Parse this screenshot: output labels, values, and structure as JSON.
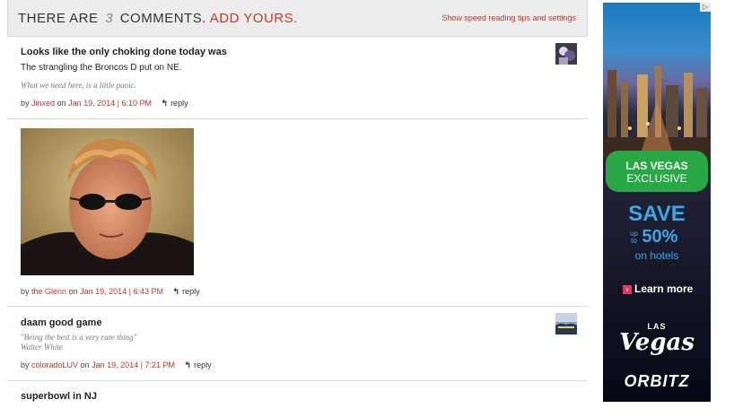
{
  "header": {
    "prefix": "THERE ARE",
    "count": "3",
    "suffix": "COMMENTS.",
    "add_label": "ADD YOURS.",
    "speed_link": "Show speed reading tips and settings"
  },
  "comments": [
    {
      "title": "Looks like the only choking done today was",
      "body": "The strangling the Broncos D put on NE.",
      "signature": [
        "What we need here, is a little panic."
      ],
      "by": "by",
      "author": "Jinxed",
      "on": "on",
      "date": "Jan 19, 2014 | 6:10 PM",
      "reply": "reply"
    },
    {
      "by": "by",
      "author": "the Glenn",
      "on": "on",
      "date": "Jan 19, 2014 | 6:43 PM",
      "reply": "reply"
    },
    {
      "title": "daam good game",
      "signature": [
        "\"Being the best is a very rare thing\"",
        "Walter White"
      ],
      "by": "by",
      "author": "coloradoLUV",
      "on": "on",
      "date": "Jan 19, 2014 | 7:21 PM",
      "reply": "reply"
    },
    {
      "title": "superbowl in NJ"
    }
  ],
  "ad": {
    "badge_line1": "LAS VEGAS",
    "badge_line2": "EXCLUSIVE",
    "save": "SAVE",
    "upto_1": "up",
    "upto_2": "to",
    "percent": "50%",
    "on_hotels": "on hotels",
    "learn_more": "Learn more",
    "logo_top": "LAS",
    "logo_script": "Vegas",
    "orbitz": "ORBITZ"
  },
  "colors": {
    "accent_red": "#c0392b",
    "ad_green": "#27a844",
    "ad_blue": "#39a8e8"
  }
}
